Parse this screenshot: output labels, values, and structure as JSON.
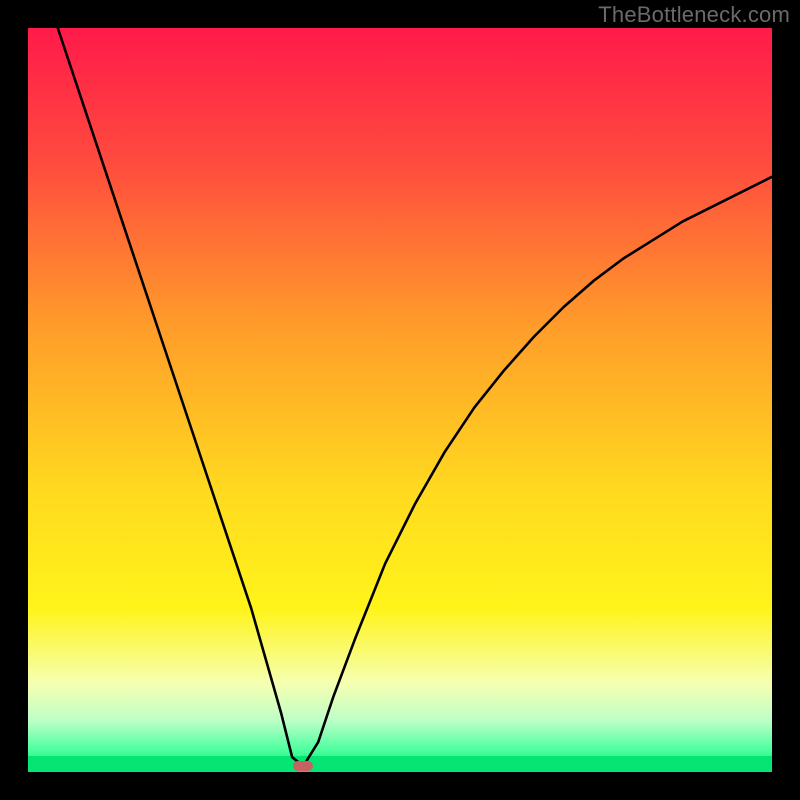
{
  "watermark": "TheBottleneck.com",
  "chart_data": {
    "type": "line",
    "title": "",
    "xlabel": "",
    "ylabel": "",
    "xlim": [
      0,
      100
    ],
    "ylim": [
      0,
      100
    ],
    "series": [
      {
        "name": "bottleneck-curve",
        "x": [
          4,
          6,
          8,
          10,
          12,
          14,
          16,
          18,
          20,
          22,
          24,
          26,
          28,
          30,
          32,
          34,
          35.5,
          37,
          39,
          41,
          44,
          48,
          52,
          56,
          60,
          64,
          68,
          72,
          76,
          80,
          84,
          88,
          92,
          96,
          100
        ],
        "y": [
          100,
          94,
          88,
          82,
          76,
          70,
          64,
          58,
          52,
          46,
          40,
          34,
          28,
          22,
          15,
          8,
          2,
          0.8,
          4,
          10,
          18,
          28,
          36,
          43,
          49,
          54,
          58.5,
          62.5,
          66,
          69,
          71.5,
          74,
          76,
          78,
          80
        ]
      }
    ],
    "marker": {
      "x": 37,
      "y": 0.8
    },
    "gradient_stops": [
      {
        "pct": 0,
        "color": "#ff1a4a"
      },
      {
        "pct": 18,
        "color": "#ff4b3e"
      },
      {
        "pct": 40,
        "color": "#ff9c2a"
      },
      {
        "pct": 62,
        "color": "#ffd91f"
      },
      {
        "pct": 78,
        "color": "#fff41a"
      },
      {
        "pct": 88,
        "color": "#f6ffb0"
      },
      {
        "pct": 93,
        "color": "#bfffc8"
      },
      {
        "pct": 97,
        "color": "#4dffa0"
      },
      {
        "pct": 100,
        "color": "#05e573"
      }
    ],
    "green_strip_height_pct": 2.2
  }
}
